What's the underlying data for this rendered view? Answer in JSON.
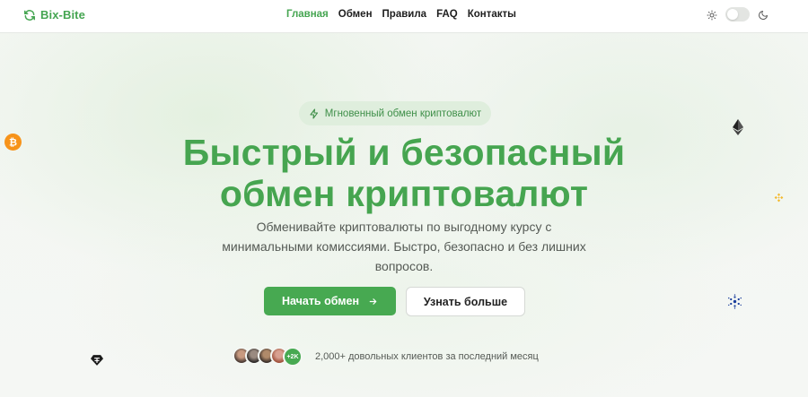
{
  "header": {
    "logo_text": "Bix-Bite",
    "nav": [
      {
        "label": "Главная",
        "active": true
      },
      {
        "label": "Обмен",
        "active": false
      },
      {
        "label": "Правила",
        "active": false
      },
      {
        "label": "FAQ",
        "active": false
      },
      {
        "label": "Контакты",
        "active": false
      }
    ]
  },
  "hero": {
    "badge": "Мгновенный обмен криптовалют",
    "title_line1": "Быстрый и безопасный",
    "title_line2": "обмен криптовалют",
    "subtitle": "Обменивайте криптовалюты по выгодному курсу с минимальными комиссиями. Быстро, безопасно и без лишних вопросов.",
    "primary_button": "Начать обмен",
    "secondary_button": "Узнать больше",
    "avatars_more": "+2K",
    "social_proof": "2,000+ довольных клиентов за последний месяц"
  },
  "floating_icons": [
    "bitcoin-icon",
    "ethereum-icon",
    "binance-icon",
    "cardano-icon",
    "tether-icon"
  ],
  "colors": {
    "accent": "#47a951",
    "badge_bg": "#dfeedd",
    "bitcoin": "#f7931a",
    "binance": "#f3ba2f",
    "cardano": "#1a3e9c"
  }
}
